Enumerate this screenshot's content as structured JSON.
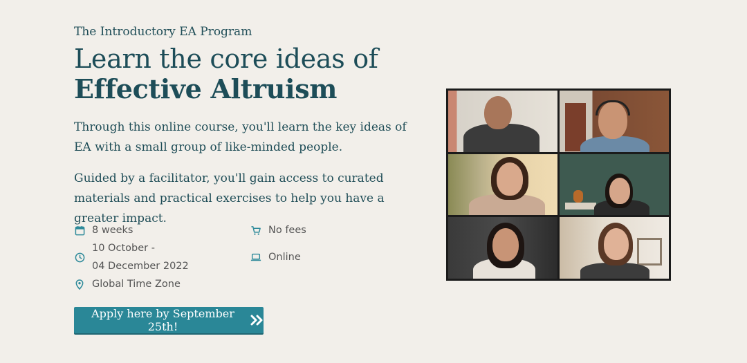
{
  "eyebrow": "The Introductory EA Program",
  "headline": {
    "line1": "Learn the core ideas of",
    "line2": "Effective Altruism"
  },
  "paragraphs": [
    "Through this online course, you'll learn the key ideas of EA with a small group of like-minded people.",
    "Guided by a facilitator, you'll gain access to curated materials and practical exercises to help you have a greater impact."
  ],
  "facts": {
    "duration": {
      "icon": "calendar-icon",
      "text": "8 weeks"
    },
    "dates": {
      "icon": "clock-icon",
      "line1": "10 October -",
      "line2": "04 December 2022"
    },
    "timezone": {
      "icon": "location-pin-icon",
      "text": "Global Time Zone"
    },
    "fees": {
      "icon": "cart-icon",
      "text": "No fees"
    },
    "mode": {
      "icon": "laptop-icon",
      "text": "Online"
    }
  },
  "cta": {
    "label": "Apply here by September 25th!",
    "icon": "double-chevron-right-icon"
  },
  "colors": {
    "background": "#f2efea",
    "heading": "#1d4d58",
    "accent": "#2a8797",
    "icon": "#2e8a9a"
  }
}
